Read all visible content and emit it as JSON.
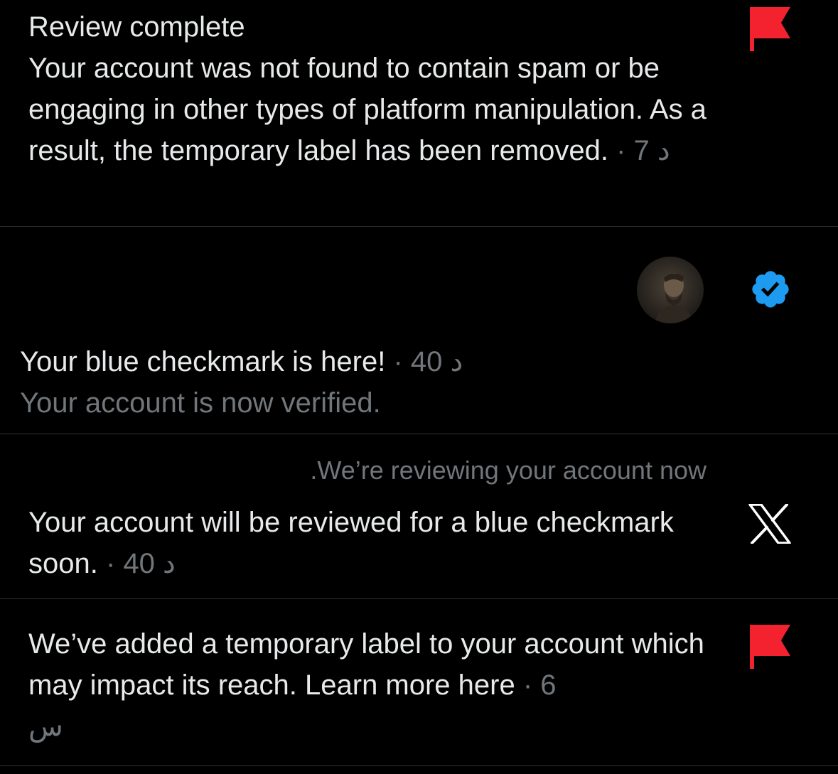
{
  "notifications": [
    {
      "type": "review_complete",
      "title": "Review complete",
      "body": "Your account was not found to contain spam or be engaging in other types of platform manipulation. As a result, the temporary label has been removed.",
      "time_sep": " · ",
      "time": "7 د",
      "icon": "flag-icon",
      "icon_color": "#f4212e"
    },
    {
      "type": "verified",
      "title": "Your blue checkmark is here!",
      "time_sep": " · ",
      "time": "40 د",
      "subtitle": "Your account is now verified.",
      "icon": "verified-badge-icon",
      "icon_color": "#1d9bf0"
    },
    {
      "type": "review_pending",
      "header": ".We’re reviewing your account now",
      "body": "Your account will be reviewed for a blue checkmark soon.",
      "time_sep": " · ",
      "time": "40 د",
      "icon": "x-logo-icon"
    },
    {
      "type": "temporary_label",
      "body": "We’ve added a temporary label to your account which may impact its reach. Learn more here",
      "time_sep": " · ",
      "time_num": "6",
      "time_unit": "س",
      "icon": "flag-icon",
      "icon_color": "#f4212e"
    }
  ],
  "colors": {
    "background": "#000000",
    "text": "#e7e9ea",
    "muted": "#71767b",
    "divider": "#2f3336",
    "flag": "#f4212e",
    "verified": "#1d9bf0"
  }
}
